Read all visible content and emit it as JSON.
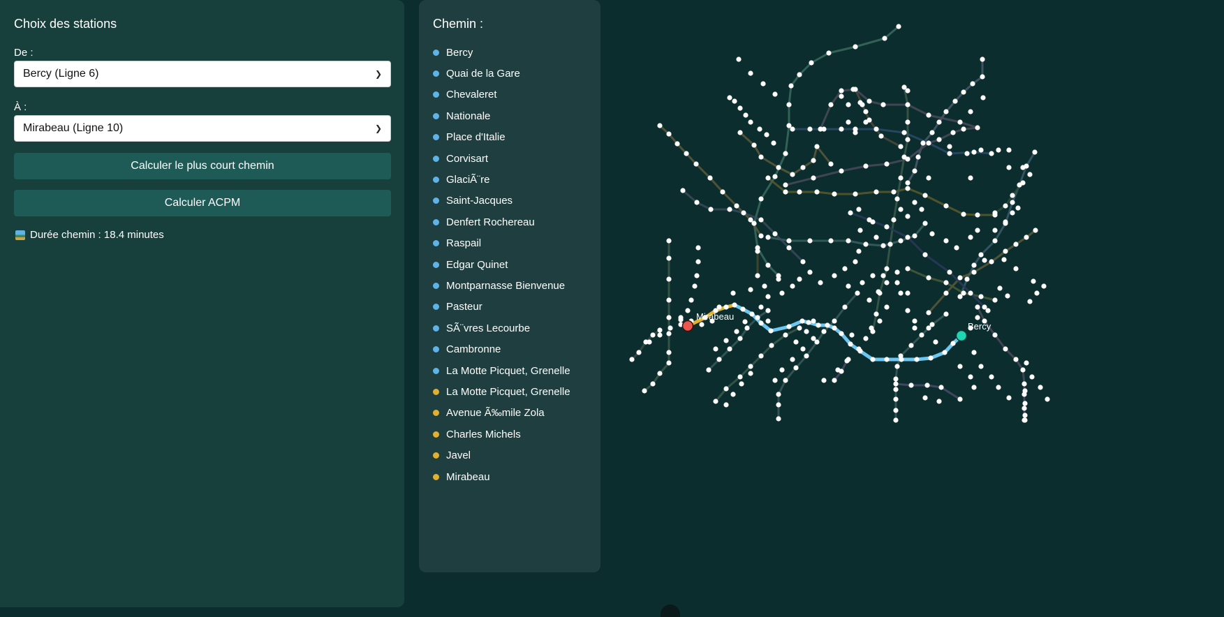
{
  "sidebar": {
    "title": "Choix des stations",
    "from_label": "De :",
    "from_value": "Bercy (Ligne 6)",
    "to_label": "À :",
    "to_value": "Mirabeau (Ligne 10)",
    "shortest_button": "Calculer le plus court chemin",
    "acpm_button": "Calculer ACPM",
    "duration_icon": "duration-icon",
    "duration_text": "Durée chemin : 18.4 minutes"
  },
  "path": {
    "title": "Chemin :",
    "stations": [
      {
        "name": "Bercy",
        "color": "#5fb3e6"
      },
      {
        "name": "Quai de la Gare",
        "color": "#5fb3e6"
      },
      {
        "name": "Chevaleret",
        "color": "#5fb3e6"
      },
      {
        "name": "Nationale",
        "color": "#5fb3e6"
      },
      {
        "name": "Place d'Italie",
        "color": "#5fb3e6"
      },
      {
        "name": "Corvisart",
        "color": "#5fb3e6"
      },
      {
        "name": "GlaciÃ¨re",
        "color": "#5fb3e6"
      },
      {
        "name": "Saint-Jacques",
        "color": "#5fb3e6"
      },
      {
        "name": "Denfert Rochereau",
        "color": "#5fb3e6"
      },
      {
        "name": "Raspail",
        "color": "#5fb3e6"
      },
      {
        "name": "Edgar Quinet",
        "color": "#5fb3e6"
      },
      {
        "name": "Montparnasse Bienvenue",
        "color": "#5fb3e6"
      },
      {
        "name": "Pasteur",
        "color": "#5fb3e6"
      },
      {
        "name": "SÃ¨vres Lecourbe",
        "color": "#5fb3e6"
      },
      {
        "name": "Cambronne",
        "color": "#5fb3e6"
      },
      {
        "name": "La Motte Picquet, Grenelle",
        "color": "#5fb3e6"
      },
      {
        "name": "La Motte Picquet, Grenelle",
        "color": "#e0b030"
      },
      {
        "name": "Avenue Ã‰mile Zola",
        "color": "#e0b030"
      },
      {
        "name": "Charles Michels",
        "color": "#e0b030"
      },
      {
        "name": "Javel",
        "color": "#e0b030"
      },
      {
        "name": "Mirabeau",
        "color": "#e0b030"
      }
    ]
  },
  "map": {
    "start_label": "Bercy",
    "end_label": "Mirabeau",
    "start_color": "#1fd6b4",
    "end_color": "#e8584e",
    "route_color_line6": "#6cc8f0",
    "route_color_line10": "#e0b030"
  }
}
